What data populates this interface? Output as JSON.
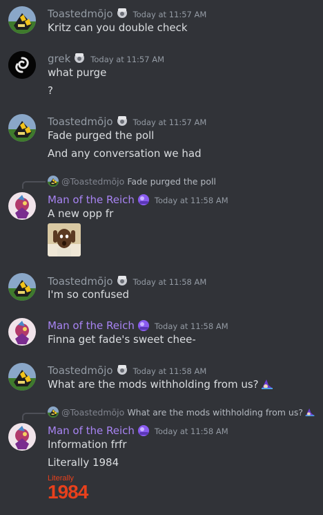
{
  "users": {
    "toasted": "Toastedmōjo",
    "grek": "grek",
    "reich": "Man of the Reich"
  },
  "messages": [
    {
      "user": "Toastedmōjo",
      "time": "Today at 11:57 AM",
      "lines": [
        "Kritz can you double check"
      ]
    },
    {
      "user": "grek",
      "time": "Today at 11:57 AM",
      "lines": [
        "what purge",
        "?"
      ]
    },
    {
      "user": "Toastedmōjo",
      "time": "Today at 11:57 AM",
      "lines": [
        "Fade purged the poll",
        "And any conversation we had"
      ]
    },
    {
      "user": "Man of the Reich",
      "time": "Today at 11:58 AM",
      "reply_to": "@Toastedmōjo",
      "reply_text": "Fade purged the poll",
      "lines": [
        "A new opp fr"
      ]
    },
    {
      "user": "Toastedmōjo",
      "time": "Today at 11:58 AM",
      "lines": [
        "I'm so confused"
      ]
    },
    {
      "user": "Man of the Reich",
      "time": "Today at 11:58 AM",
      "lines": [
        "Finna get fade's sweet chee-"
      ]
    },
    {
      "user": "Toastedmōjo",
      "time": "Today at 11:58 AM",
      "lines": [
        "What are the mods withholding from us?"
      ]
    },
    {
      "user": "Man of the Reich",
      "time": "Today at 11:58 AM",
      "reply_to": "@Toastedmōjo",
      "reply_text": "What are the mods withholding from us?",
      "lines": [
        "Information frfr",
        "Literally 1984"
      ]
    }
  ],
  "sticker": {
    "top": "Literally",
    "bottom": "1984"
  },
  "colors": {
    "background": "#313338",
    "purple_name": "#a884f3",
    "grey_name": "#949ba4",
    "sticker_red": "#e8401c"
  }
}
